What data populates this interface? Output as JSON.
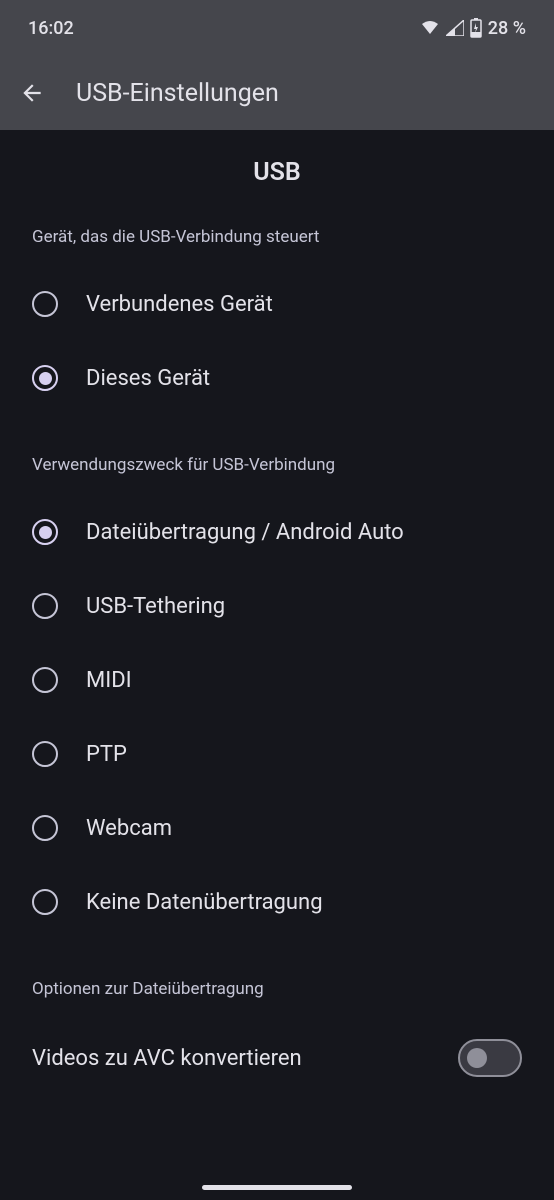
{
  "status": {
    "time": "16:02",
    "battery_percent": "28 %"
  },
  "appbar": {
    "title": "USB-Einstellungen"
  },
  "header": {
    "title": "USB"
  },
  "section1": {
    "label": "Gerät, das die USB-Verbindung steuert",
    "options": [
      {
        "label": "Verbundenes Gerät",
        "selected": false
      },
      {
        "label": "Dieses Gerät",
        "selected": true
      }
    ]
  },
  "section2": {
    "label": "Verwendungszweck für USB-Verbindung",
    "options": [
      {
        "label": "Dateiübertragung / Android Auto",
        "selected": true
      },
      {
        "label": "USB-Tethering",
        "selected": false
      },
      {
        "label": "MIDI",
        "selected": false
      },
      {
        "label": "PTP",
        "selected": false
      },
      {
        "label": "Webcam",
        "selected": false
      },
      {
        "label": "Keine Datenübertragung",
        "selected": false
      }
    ]
  },
  "section3": {
    "label": "Optionen zur Dateiübertragung",
    "toggle": {
      "label": "Videos zu AVC konvertieren",
      "enabled": false
    }
  }
}
